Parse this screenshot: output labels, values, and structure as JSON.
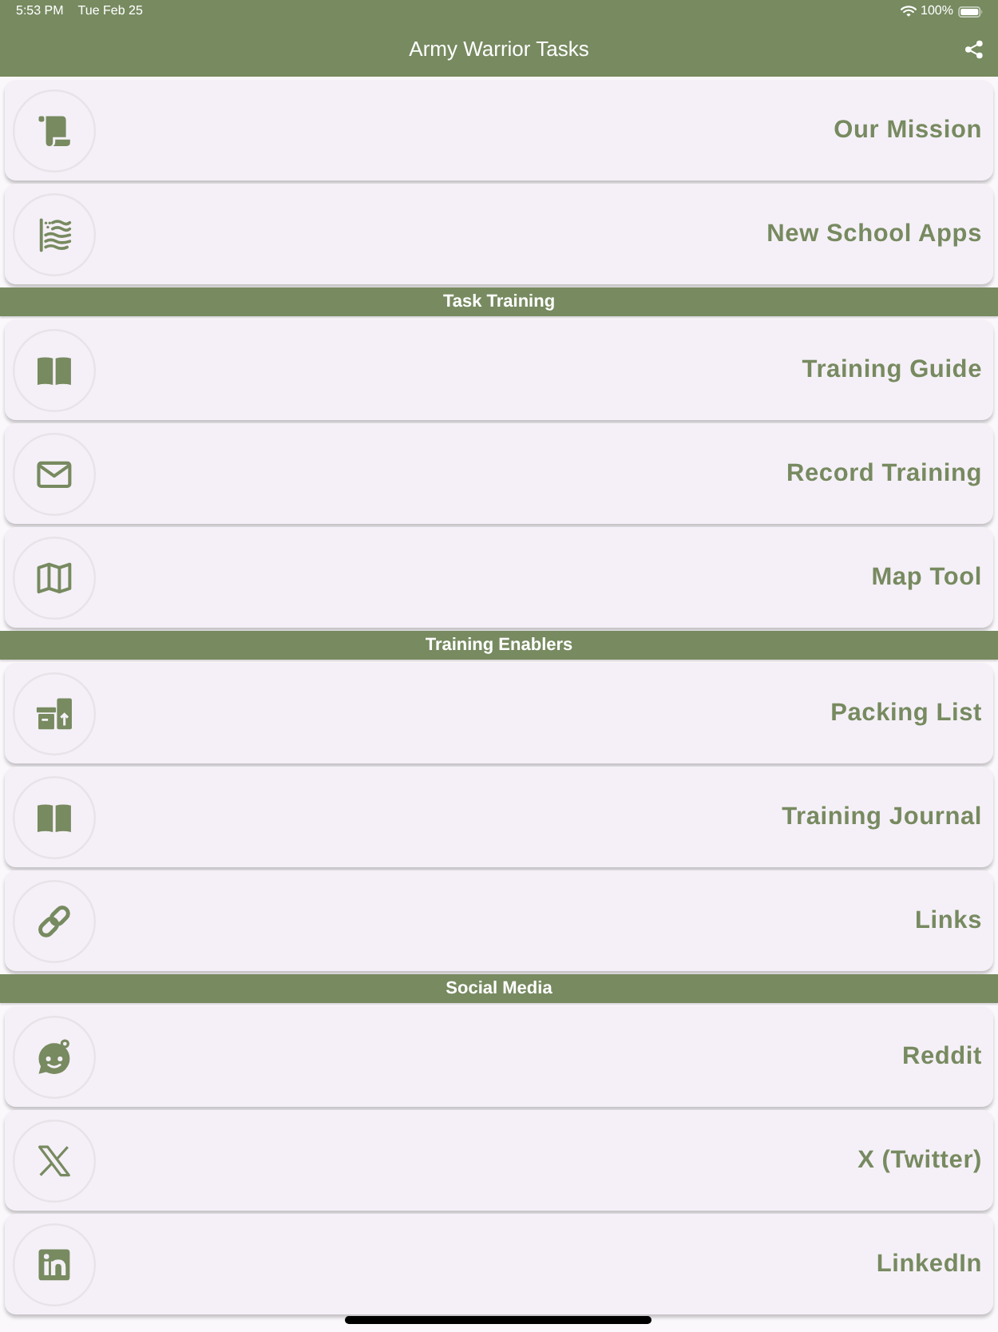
{
  "status_bar": {
    "time": "5:53 PM",
    "date": "Tue Feb 25",
    "battery": "100%"
  },
  "app_bar": {
    "title": "Army Warrior Tasks"
  },
  "sections": [
    {
      "items": [
        {
          "label": "Our Mission"
        },
        {
          "label": "New School Apps"
        }
      ]
    },
    {
      "header": "Task Training",
      "items": [
        {
          "label": "Training Guide"
        },
        {
          "label": "Record Training"
        },
        {
          "label": "Map Tool"
        }
      ]
    },
    {
      "header": "Training Enablers",
      "items": [
        {
          "label": "Packing List"
        },
        {
          "label": "Training Journal"
        },
        {
          "label": "Links"
        }
      ]
    },
    {
      "header": "Social Media",
      "items": [
        {
          "label": "Reddit"
        },
        {
          "label": "X (Twitter)"
        },
        {
          "label": "LinkedIn"
        }
      ]
    }
  ]
}
